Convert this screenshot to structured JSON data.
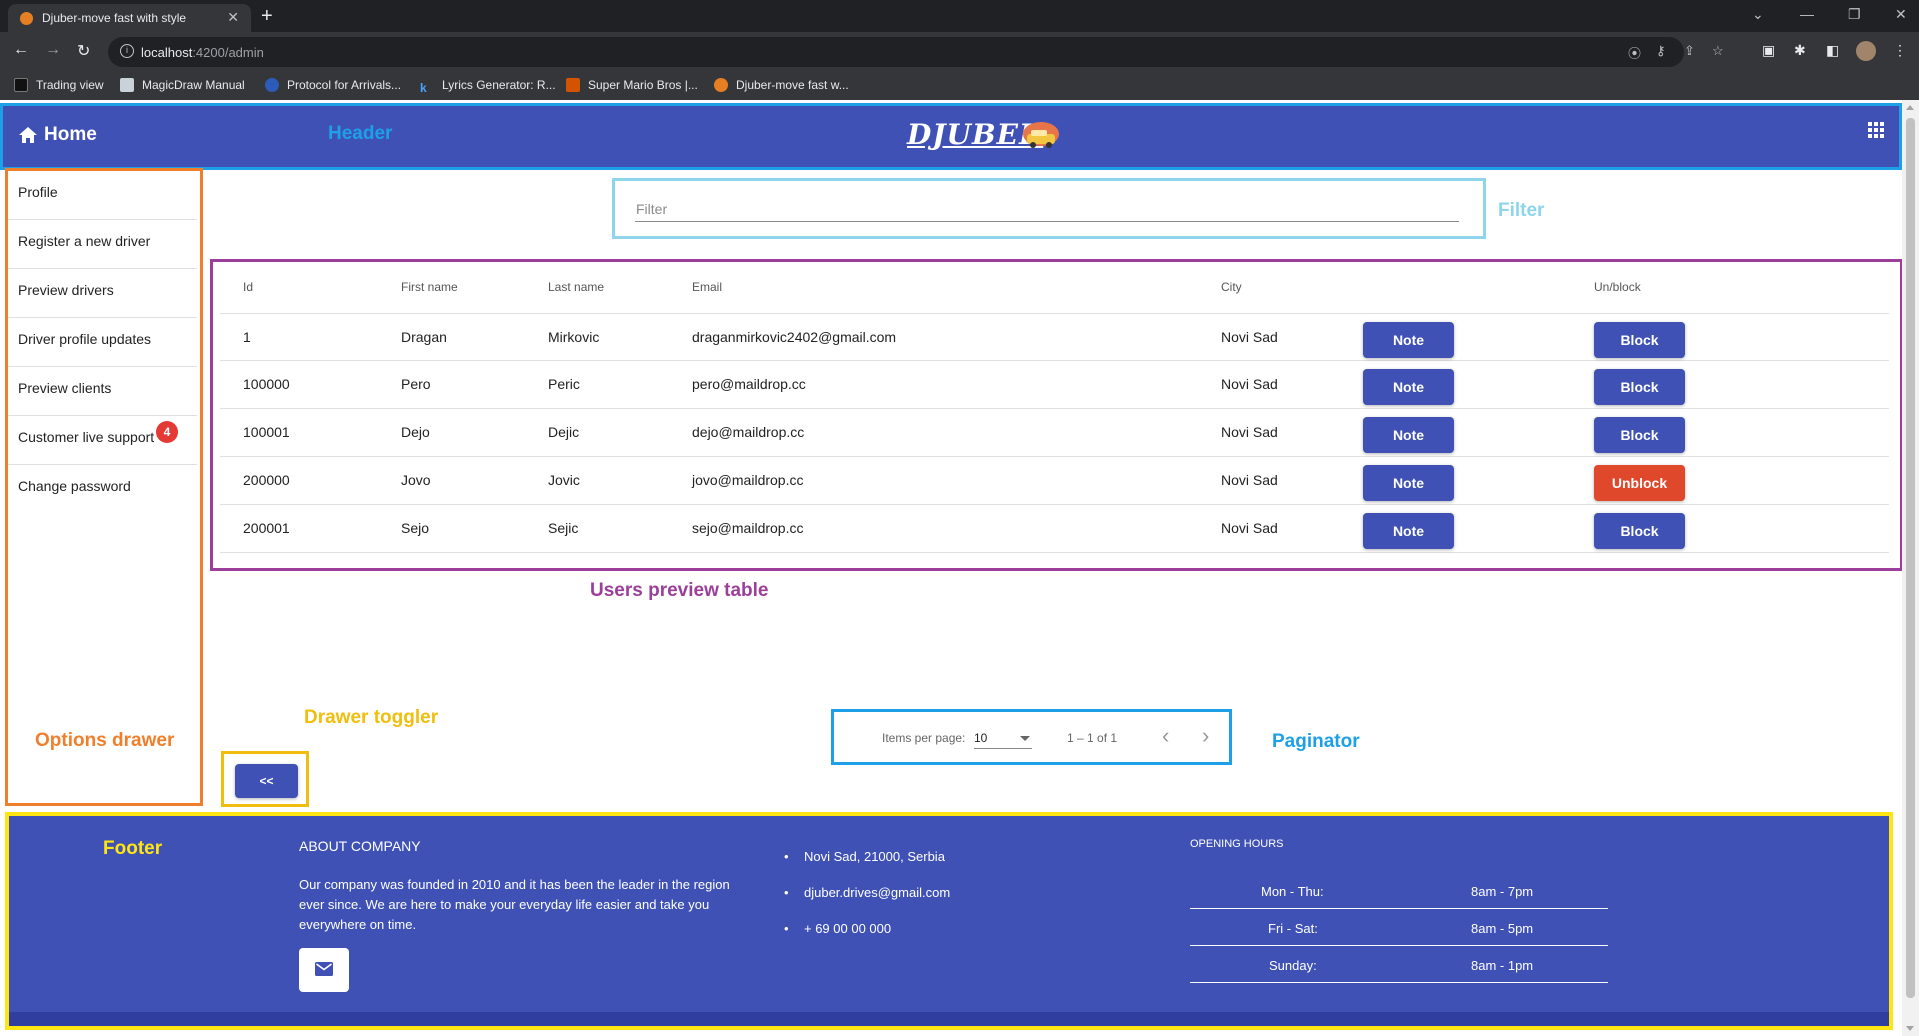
{
  "browser": {
    "tab_title": "Djuber-move fast with style",
    "url_host": "localhost",
    "url_rest": ":4200/admin",
    "bookmarks": [
      "Trading view",
      "MagicDraw Manual",
      "Protocol for Arrivals...",
      "Lyrics Generator: R...",
      "Super Mario Bros |...",
      "Djuber-move fast w..."
    ]
  },
  "header": {
    "home_label": "Home",
    "logo_text": "DJUBER",
    "annotation": "Header"
  },
  "drawer": {
    "items": [
      {
        "label": "Profile"
      },
      {
        "label": "Register a new driver"
      },
      {
        "label": "Preview drivers"
      },
      {
        "label": "Driver profile updates"
      },
      {
        "label": "Preview clients"
      },
      {
        "label": "Customer live support",
        "badge": "4"
      },
      {
        "label": "Change password"
      }
    ],
    "annotation": "Options drawer"
  },
  "filter": {
    "placeholder": "Filter",
    "annotation": "Filter"
  },
  "table": {
    "columns": [
      "Id",
      "First name",
      "Last name",
      "Email",
      "City",
      "Un/block"
    ],
    "rows": [
      {
        "id": "1",
        "first": "Dragan",
        "last": "Mirkovic",
        "email": "draganmirkovic2402@gmail.com",
        "city": "Novi Sad",
        "note": "Note",
        "action": "Block"
      },
      {
        "id": "100000",
        "first": "Pero",
        "last": "Peric",
        "email": "pero@maildrop.cc",
        "city": "Novi Sad",
        "note": "Note",
        "action": "Block"
      },
      {
        "id": "100001",
        "first": "Dejo",
        "last": "Dejic",
        "email": "dejo@maildrop.cc",
        "city": "Novi Sad",
        "note": "Note",
        "action": "Block"
      },
      {
        "id": "200000",
        "first": "Jovo",
        "last": "Jovic",
        "email": "jovo@maildrop.cc",
        "city": "Novi Sad",
        "note": "Note",
        "action": "Unblock"
      },
      {
        "id": "200001",
        "first": "Sejo",
        "last": "Sejic",
        "email": "sejo@maildrop.cc",
        "city": "Novi Sad",
        "note": "Note",
        "action": "Block"
      }
    ],
    "annotation": "Users preview table"
  },
  "paginator": {
    "items_per_page_label": "Items per page:",
    "page_size": "10",
    "range": "1 – 1 of 1",
    "annotation": "Paginator"
  },
  "toggler": {
    "label": "<<",
    "annotation": "Drawer toggler"
  },
  "footer": {
    "annotation": "Footer",
    "about_title": "ABOUT COMPANY",
    "about_text": "Our company was founded in 2010 and it has been the leader in the region ever since. We are here to make your everyday life easier and take you everywhere on time.",
    "contacts": [
      "Novi Sad, 21000, Serbia",
      "djuber.drives@gmail.com",
      "+ 69 00 00 000"
    ],
    "hours_title": "OPENING HOURS",
    "hours": [
      {
        "days": "Mon - Thu:",
        "time": "8am - 7pm"
      },
      {
        "days": "Fri - Sat:",
        "time": "8am - 5pm"
      },
      {
        "days": "Sunday:",
        "time": "8am - 1pm"
      }
    ]
  },
  "colors": {
    "primary": "#3f51b5",
    "danger": "#e0482c",
    "header_annotation": "#1ea0e8",
    "filter_annotation": "#8ed5ec",
    "table_annotation": "#9b3f9b",
    "drawer_annotation": "#f07f2c",
    "footer_annotation": "#ffe512",
    "toggler_annotation": "#f0be0c"
  }
}
